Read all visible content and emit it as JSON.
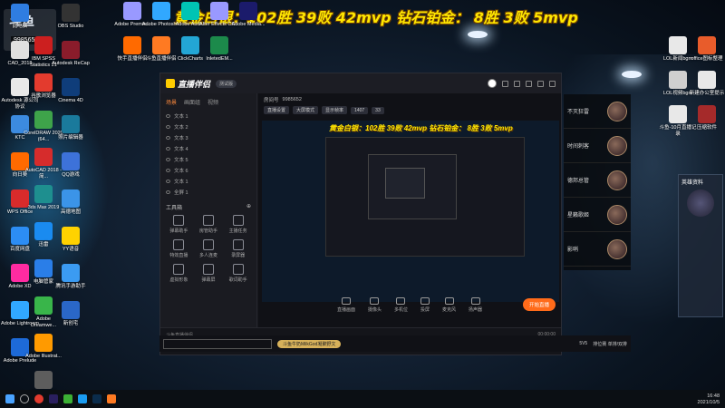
{
  "banner": "黄金白银：102胜 39败 42mvp 钻石铂金： 8胜 3败 5mvp",
  "overlay": {
    "logo": "斗鱼",
    "room": "9985652"
  },
  "desktop_left": [
    {
      "label": "此电脑",
      "color": "#2f7de1"
    },
    {
      "label": "CAD_2018",
      "color": "#e0e0e0"
    },
    {
      "label": "Autodesk 源公司协议",
      "color": "#e8e8e8"
    },
    {
      "label": "KTC",
      "color": "#3c8be0"
    },
    {
      "label": "向日葵",
      "color": "#ff6a00"
    },
    {
      "label": "WPS Office",
      "color": "#d92b2b"
    },
    {
      "label": "百度网盘",
      "color": "#2c8df4"
    },
    {
      "label": "Adobe XD",
      "color": "#ff2ba1"
    },
    {
      "label": "Adobe Lightroom",
      "color": "#31a8ff"
    },
    {
      "label": "Adobe Prelude",
      "color": "#1d6ad8"
    }
  ],
  "desktop_col2": [
    {
      "label": "IBM SPSS Statistics 21",
      "color": "#cc1f1f"
    },
    {
      "label": "谷歌浏览器",
      "color": "#e33b2e"
    },
    {
      "label": "CorelDRAW 2020 (64...",
      "color": "#3ea34a"
    },
    {
      "label": "AutoCAD 2018 - 简...",
      "color": "#d62c2c"
    },
    {
      "label": "3ds Max 2019",
      "color": "#1e8f8f"
    },
    {
      "label": "迅雷",
      "color": "#1a8bf0"
    },
    {
      "label": "电脑管家",
      "color": "#2a7ee8"
    },
    {
      "label": "Adobe Dreamwe...",
      "color": "#39b54a"
    },
    {
      "label": "Adobe Illustrat...",
      "color": "#ff9a00"
    },
    {
      "label": "图钉专业版",
      "color": "#5d5d5d"
    }
  ],
  "desktop_col3": [
    {
      "label": "OBS Studio",
      "color": "#333"
    },
    {
      "label": "Autodesk ReCap",
      "color": "#8a1c2b"
    },
    {
      "label": "Cinema 4D",
      "color": "#0f3d7a"
    },
    {
      "label": "照片编辑器",
      "color": "#1a7a9c"
    },
    {
      "label": "QQ游戏",
      "color": "#3d72d9"
    },
    {
      "label": "高德地图",
      "color": "#3b94e8"
    },
    {
      "label": "YY语音",
      "color": "#ffd200"
    },
    {
      "label": "腾讯手游助手",
      "color": "#3b9bf2"
    },
    {
      "label": "新创宅",
      "color": "#2a67c8"
    }
  ],
  "desktop_top": [
    {
      "label": "Adobe Premie...",
      "color": "#9999ff"
    },
    {
      "label": "Adobe Photosh...",
      "color": "#31a8ff"
    },
    {
      "label": "Adobe Audi...",
      "color": "#00c4b4"
    },
    {
      "label": "After Effects CC...",
      "color": "#9999ff"
    },
    {
      "label": "Adobe Media...",
      "color": "#1b1b6b"
    },
    {
      "label": "快手直播伴侣",
      "color": "#ff6a00"
    },
    {
      "label": "斗鱼直播伴侣",
      "color": "#ff7a22"
    },
    {
      "label": "ClickCharts",
      "color": "#23a6d5"
    },
    {
      "label": "InletedEM...",
      "color": "#1c8a4b"
    }
  ],
  "desktop_right": [
    {
      "label": "LOL新闻bgm",
      "color": "#e8e8e8"
    },
    {
      "label": "office图标整理",
      "color": "#e85c2b"
    },
    {
      "label": "LOL视频bgm",
      "color": "#cfcfcf"
    },
    {
      "label": "新建办公室提示",
      "color": "#e8e8e8"
    },
    {
      "label": "斗鱼-10月直播记录",
      "color": "#e8e8e8"
    },
    {
      "label": "压缩软件",
      "color": "#a52a2a"
    }
  ],
  "app": {
    "title": "直播伴侣",
    "title_chip": "测试版",
    "tabs": [
      "场景",
      "画面组",
      "视频"
    ],
    "scenes": [
      "文本 1",
      "文本 2",
      "文本 3",
      "文本 4",
      "文本 5",
      "文本 6",
      "文本 1",
      "全屏 1"
    ],
    "tools_title": "工具箱",
    "tools": [
      "弹幕助手",
      "房管助手",
      "主播任务",
      "特效直播",
      "多人连麦",
      "录屏器",
      "虚拟形象",
      "弹幕屏",
      "歌词助手"
    ],
    "room_label": "房间号",
    "room_id": "9985652",
    "stage_pills": [
      "直播设置",
      "大屏模式",
      "显示帧率",
      "1407",
      "33"
    ],
    "preview_banner": "黄金白银：102胜 39败 42mvp 钻石铂金： 8胜 3败 5mvp",
    "controls": [
      "直播画面",
      "摄像头",
      "多机位",
      "投屏",
      "麦克风",
      "扬声器"
    ],
    "start_button": "开始直播",
    "status": "斗鱼直播伴侣",
    "time": "00:00:00"
  },
  "roles": [
    {
      "name": "不灭狂雷"
    },
    {
      "name": "时间刺客"
    },
    {
      "name": "德邦总管"
    },
    {
      "name": "星籁歌姬"
    },
    {
      "name": "影哨"
    }
  ],
  "profile_title": "英雄资料",
  "gift_bar": {
    "gift_text": "斗鱼牛奶MilkGod凝聚野文",
    "rank": "排位赛 单排/双排",
    "level": "5V5"
  },
  "clock": {
    "time": "16:48",
    "date": "2021/10/5"
  },
  "colors": {
    "accent": "#ff8a3d",
    "banner": "#ffe600",
    "start": "#ff6b1a"
  }
}
